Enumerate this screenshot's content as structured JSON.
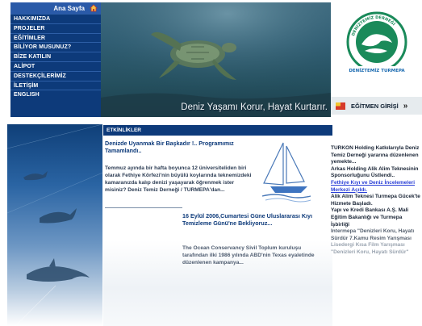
{
  "nav": {
    "home_label": "Ana Sayfa",
    "home_icon": "house-icon",
    "items": [
      "HAKKIMIZDA",
      "PROJELER",
      "EĞİTİMLER",
      "BİLİYOR MUSUNUZ?",
      "BİZE KATILIN",
      "ALİPOT",
      "DESTEKÇİLERİMİZ",
      "İLETİŞİM",
      "ENGLISH"
    ],
    "background_color": "#0d3a7a"
  },
  "hero": {
    "slogan": "Deniz Yaşamı Korur, Hayat Kurtarır."
  },
  "logo": {
    "text_top": "DENİZTEMİZ DERNEĞİ",
    "text_middle": "DENİZTEMİZ TURMEPA",
    "accent_color": "#1a8a5a"
  },
  "login": {
    "label": "EĞİTMEN GİRİŞİ",
    "arrow": "»",
    "icon": "flag-icon"
  },
  "events": {
    "header": "ETKİNLİKLER",
    "item1_title": "Denizde Uyanmak Bir Başkadır !.. Programımız Tamamlandı..",
    "item1_body": "Temmuz ayında bir hafta boyunca 12 üniversiteliden biri olarak Fethiye Körfezi'nin büyülü koylarında teknemizdeki kamaranızda kalıp denizi yaşayarak öğrenmek ister misiniz? Deniz Temiz Derneği / TURMEPA'dan...",
    "item2_title": "16 Eylül 2006,Cumartesi Güne Uluslararası Kıyı Temizleme Günü'ne Bekliyoruz...",
    "item2_body": "The Ocean Conservancy Sivil Toplum kuruluşu tarafından ilki 1986 yılında ABD'nin Texas eyaletinde düzenlenen kampanya..."
  },
  "news": {
    "items": [
      {
        "text": "TURKON Holding Katkılarıyla Deniz Temiz Derneği yararına düzenlenen yemekte...",
        "style": "normal"
      },
      {
        "text": "Arkas Holding Alik Alim Teknesinin Sponsorluğunu Üstlendi..",
        "style": "normal"
      },
      {
        "text": "Fethiye Kıyı ve Deniz İncelemeleri Merkezi Açıldı.",
        "style": "link"
      },
      {
        "text": "Alik Alim Teknesi Turmepa Gücek'te Hizmete Başladı.",
        "style": "normal"
      },
      {
        "text": "Yapı ve Kredi Bankası A.Ş. Mali Eğitim Bakanlığı ve Turmepa İşbirliği",
        "style": "normal"
      },
      {
        "text": "Intermepa \"Denizleri Koru, Hayatı Sürdür 7.Kamu Resim Yarışması",
        "style": "fade1"
      },
      {
        "text": "Lisedergi Kısa Film Yarışması \"Denizleri Koru, Hayatı Sürdür\"",
        "style": "fade2"
      }
    ]
  }
}
